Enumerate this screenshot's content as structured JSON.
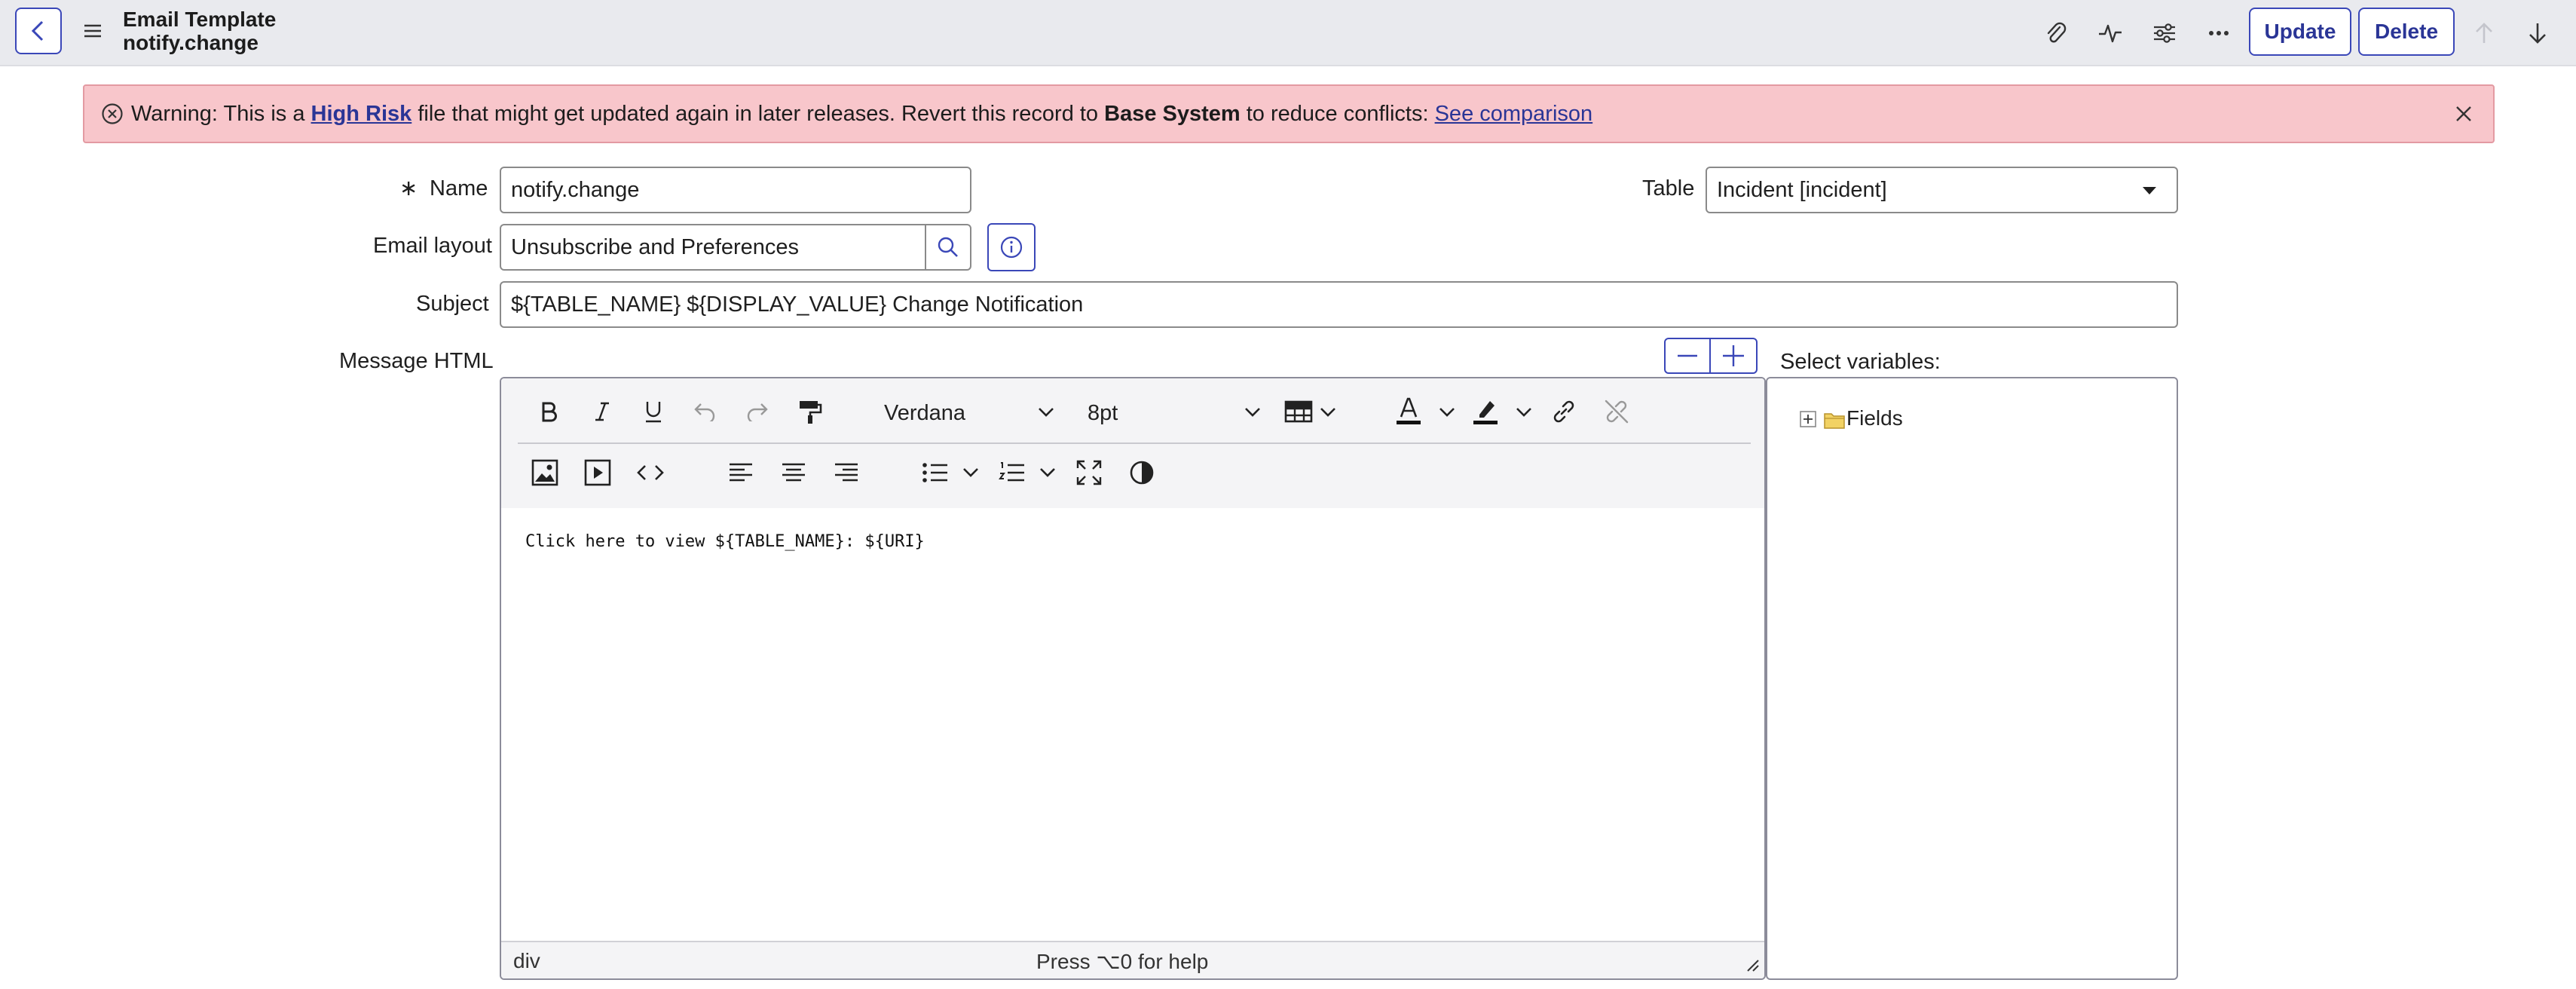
{
  "header": {
    "title": "Email Template",
    "subtitle": "notify.change",
    "update_label": "Update",
    "delete_label": "Delete"
  },
  "warning": {
    "prefix": "Warning: This is a ",
    "risk_link": "High Risk",
    "middle": " file that might get updated again in later releases. Revert this record to ",
    "base_system": "Base System",
    "suffix": " to reduce conflicts: ",
    "comparison_link": "See comparison"
  },
  "form": {
    "required_mark": "∗",
    "name_label": "Name",
    "name_value": "notify.change",
    "table_label": "Table",
    "table_value": "Incident [incident]",
    "email_layout_label": "Email layout",
    "email_layout_value": "Unsubscribe and Preferences",
    "subject_label": "Subject",
    "subject_value": "${TABLE_NAME} ${DISPLAY_VALUE} Change Notification",
    "message_label": "Message HTML",
    "variables_label": "Select variables:"
  },
  "editor": {
    "font_family": "Verdana",
    "font_size": "8pt",
    "content": "Click here to view ${TABLE_NAME}: ${URI}",
    "status_path": "div",
    "help_text": "Press ⌥0 for help"
  },
  "variables": {
    "tree_root": "Fields"
  },
  "colors": {
    "accent": "#3a47b8",
    "warning_bg": "#f8c6cb",
    "header_bg": "#e9eaee"
  }
}
